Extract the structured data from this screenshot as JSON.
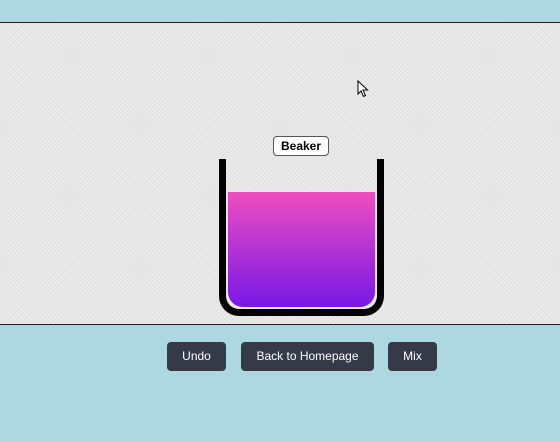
{
  "beaker": {
    "label": "Beaker",
    "fill_level": 0.78,
    "liquid_color_top": "#ee4ec0",
    "liquid_color_bottom": "#7818e6"
  },
  "controls": {
    "undo_label": "Undo",
    "home_label": "Back to Homepage",
    "mix_label": "Mix"
  },
  "colors": {
    "background": "#add8e1",
    "stage": "#ececec",
    "button": "#343a48",
    "button_text": "#ffffff"
  },
  "icons": {
    "cursor": "mouse-pointer-icon"
  }
}
